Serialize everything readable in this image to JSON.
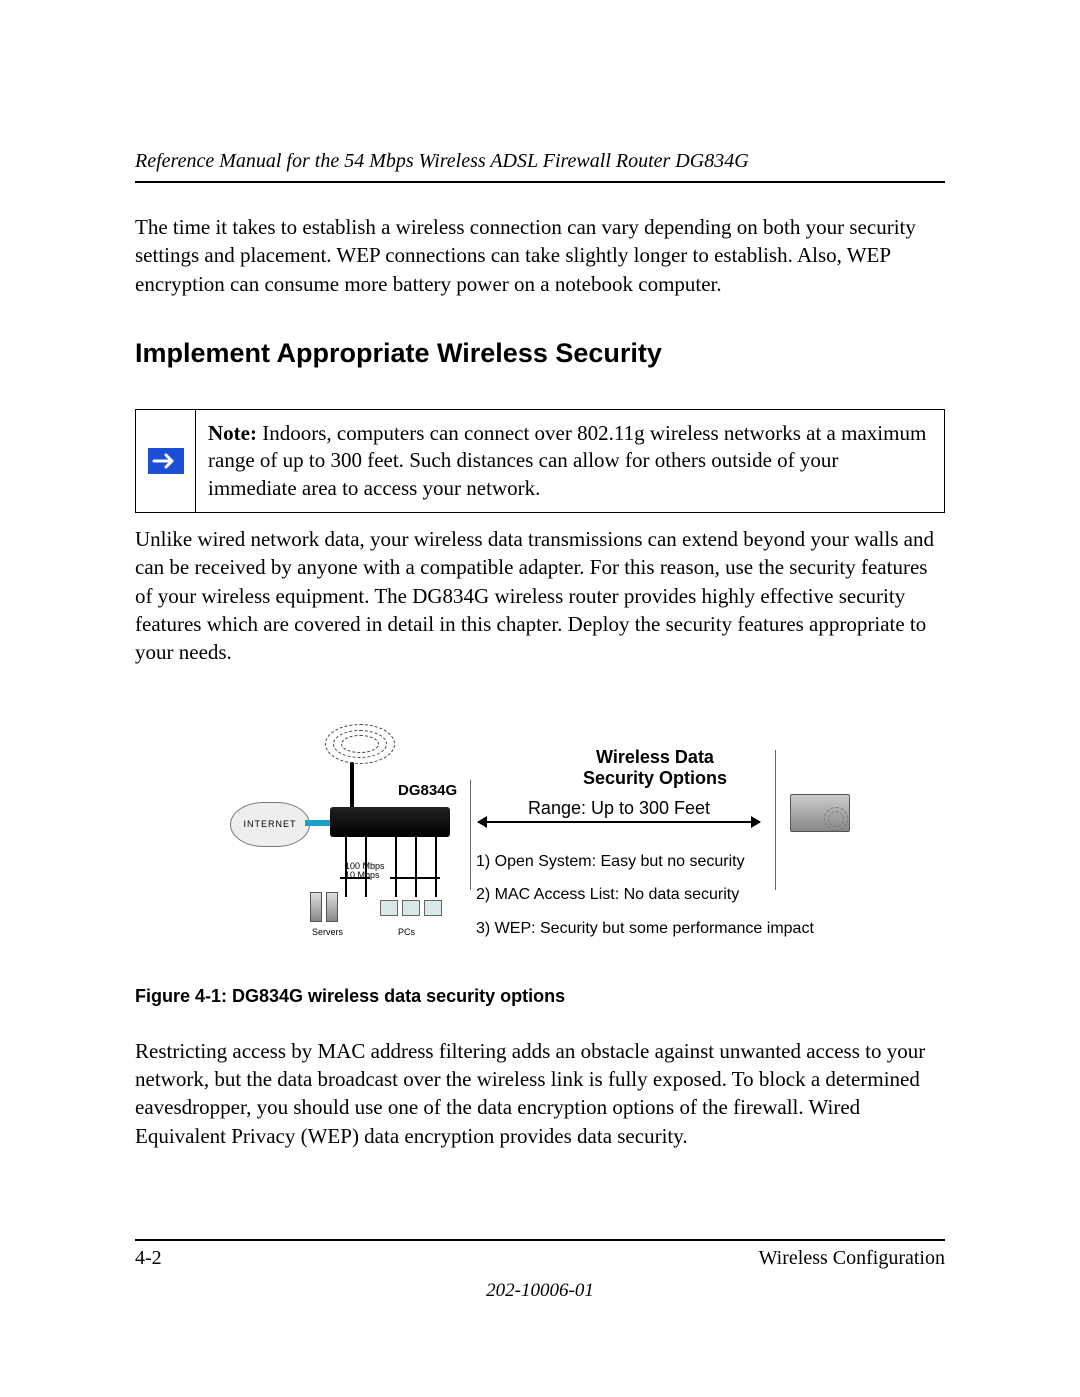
{
  "header": {
    "running_title": "Reference Manual for the 54 Mbps Wireless ADSL Firewall Router DG834G"
  },
  "body": {
    "intro_para": "The time it takes to establish a wireless connection can vary depending on both your security settings and placement. WEP connections can take slightly longer to establish. Also, WEP encryption can consume more battery power on a notebook computer.",
    "section_heading": "Implement Appropriate Wireless Security",
    "note": {
      "label": "Note:",
      "lead": " Indoors, computers can connect over 802.11g wireless networks at a maximum range of up to 300 feet. ",
      "rest": "Such distances can allow for others outside of your immediate area to access your network."
    },
    "after_note_para": "Unlike wired network data, your wireless data transmissions can extend beyond your walls and can be received by anyone with a compatible adapter. For this reason, use the security features of your wireless equipment. The DG834G wireless router provides highly effective security features which are covered in detail in this chapter. Deploy the security features appropriate to your needs.",
    "figure": {
      "router_label": "DG834G",
      "cloud_label": "INTERNET",
      "speed_line1": "100 Mbps",
      "speed_line2": "10 Mbps",
      "servers_label": "Servers",
      "pcs_label": "PCs",
      "options_title_l1": "Wireless Data",
      "options_title_l2": "Security Options",
      "range_text": "Range: Up to 300 Feet",
      "opts": [
        "1) Open System:  Easy but no security",
        "2) MAC Access List:  No data security",
        "3) WEP:  Security but some performance impact"
      ]
    },
    "figure_caption": "Figure 4-1:  DG834G wireless data security options",
    "closing_para": "Restricting access by MAC address filtering adds an obstacle against unwanted access to your network, but the data broadcast over the wireless link is fully exposed. To block a determined eavesdropper, you should use one of the data encryption options of the firewall. Wired Equivalent Privacy (WEP) data encryption provides data security."
  },
  "footer": {
    "page_num": "4-2",
    "section": "Wireless Configuration",
    "doc_number": "202-10006-01"
  }
}
